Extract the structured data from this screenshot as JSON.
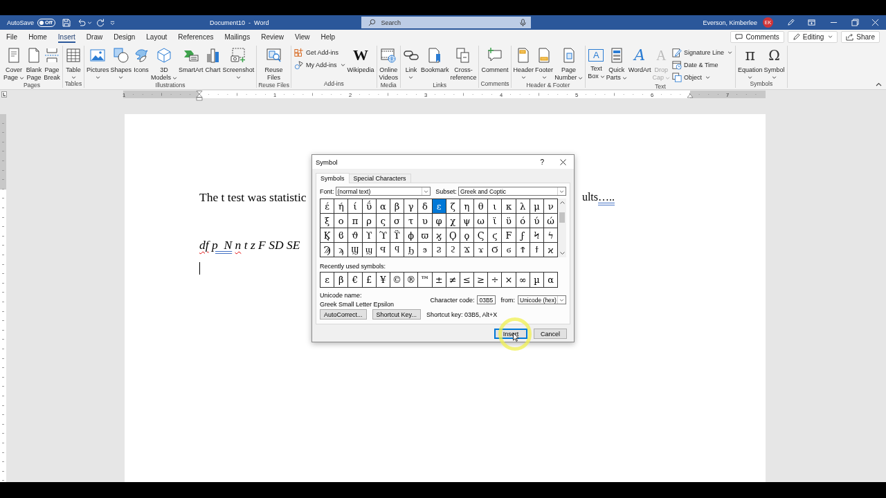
{
  "title_bar": {
    "autosave": {
      "label": "AutoSave",
      "state_label": "Off",
      "on": false
    },
    "title": "Document10  -  Word",
    "search": {
      "placeholder": "Search"
    },
    "user": {
      "name": "Everson, Kimberlee",
      "initials": "EK"
    }
  },
  "ribbon_tabs": [
    {
      "label": "File",
      "selected": false
    },
    {
      "label": "Home",
      "selected": false
    },
    {
      "label": "Insert",
      "selected": true
    },
    {
      "label": "Draw",
      "selected": false
    },
    {
      "label": "Design",
      "selected": false
    },
    {
      "label": "Layout",
      "selected": false
    },
    {
      "label": "References",
      "selected": false
    },
    {
      "label": "Mailings",
      "selected": false
    },
    {
      "label": "Review",
      "selected": false
    },
    {
      "label": "View",
      "selected": false
    },
    {
      "label": "Help",
      "selected": false
    }
  ],
  "ribbon_actions": [
    {
      "label": "Comments",
      "dropdown": false
    },
    {
      "label": "Editing",
      "dropdown": true
    },
    {
      "label": "Share",
      "dropdown": false
    }
  ],
  "ribbon_groups": [
    {
      "label": "Pages",
      "commands": [
        {
          "kind": "large",
          "label": "Cover Page",
          "dropdown": true,
          "disabled": false
        },
        {
          "kind": "large",
          "label": "Blank Page",
          "dropdown": false,
          "disabled": false
        },
        {
          "kind": "large",
          "label": "Page Break",
          "dropdown": false,
          "disabled": false
        }
      ]
    },
    {
      "label": "Tables",
      "commands": [
        {
          "kind": "large",
          "label": "Table",
          "dropdown": true,
          "disabled": false
        }
      ]
    },
    {
      "label": "Illustrations",
      "commands": [
        {
          "kind": "large",
          "label": "Pictures",
          "dropdown": true,
          "disabled": false
        },
        {
          "kind": "large",
          "label": "Shapes",
          "dropdown": true,
          "disabled": false
        },
        {
          "kind": "large",
          "label": "Icons",
          "dropdown": false,
          "disabled": false
        },
        {
          "kind": "large",
          "label": "3D Models",
          "dropdown": true,
          "disabled": false
        },
        {
          "kind": "large",
          "label": "SmartArt",
          "dropdown": false,
          "disabled": false
        },
        {
          "kind": "large",
          "label": "Chart",
          "dropdown": false,
          "disabled": false
        },
        {
          "kind": "large",
          "label": "Screenshot",
          "dropdown": true,
          "disabled": false
        }
      ]
    },
    {
      "label": "Reuse Files",
      "commands": [
        {
          "kind": "large",
          "label": "Reuse Files",
          "dropdown": false,
          "disabled": false
        }
      ]
    },
    {
      "label": "Add-ins",
      "commands": [
        {
          "kind": "small",
          "label": "Get Add-ins",
          "dropdown": false,
          "disabled": false
        },
        {
          "kind": "small",
          "label": "My Add-ins",
          "dropdown": true,
          "disabled": false
        },
        {
          "kind": "large",
          "label": "Wikipedia",
          "glyph": "W",
          "dropdown": false,
          "disabled": false
        }
      ]
    },
    {
      "label": "Media",
      "commands": [
        {
          "kind": "large",
          "label": "Online Videos",
          "dropdown": false,
          "disabled": false
        }
      ]
    },
    {
      "label": "Links",
      "commands": [
        {
          "kind": "large",
          "label": "Link",
          "dropdown": true,
          "disabled": false
        },
        {
          "kind": "large",
          "label": "Bookmark",
          "dropdown": false,
          "disabled": false
        },
        {
          "kind": "large",
          "label": "Cross-reference",
          "dropdown": false,
          "disabled": false
        }
      ]
    },
    {
      "label": "Comments",
      "commands": [
        {
          "kind": "large",
          "label": "Comment",
          "dropdown": false,
          "disabled": false
        }
      ]
    },
    {
      "label": "Header & Footer",
      "commands": [
        {
          "kind": "large",
          "label": "Header",
          "dropdown": true,
          "disabled": false
        },
        {
          "kind": "large",
          "label": "Footer",
          "dropdown": true,
          "disabled": false
        },
        {
          "kind": "large",
          "label": "Page Number",
          "dropdown": true,
          "disabled": false
        }
      ]
    },
    {
      "label": "Text",
      "commands": [
        {
          "kind": "large",
          "label": "Text Box",
          "glyph": "A",
          "dropdown": true,
          "disabled": false
        },
        {
          "kind": "large",
          "label": "Quick Parts",
          "dropdown": true,
          "disabled": false
        },
        {
          "kind": "large",
          "label": "WordArt",
          "glyph": "A",
          "dropdown": false,
          "disabled": false
        },
        {
          "kind": "large",
          "label": "Drop Cap",
          "glyph": "A",
          "dropdown": true,
          "disabled": true
        },
        {
          "kind": "small",
          "label": "Signature Line",
          "dropdown": true,
          "disabled": false
        },
        {
          "kind": "small",
          "label": "Date & Time",
          "dropdown": false,
          "disabled": false
        },
        {
          "kind": "small",
          "label": "Object",
          "dropdown": true,
          "disabled": false
        }
      ]
    },
    {
      "label": "Symbols",
      "commands": [
        {
          "kind": "large",
          "label": "Equation",
          "glyph": "π",
          "dropdown": true,
          "disabled": false
        },
        {
          "kind": "large",
          "label": "Symbol",
          "glyph": "Ω",
          "dropdown": true,
          "disabled": false
        }
      ]
    }
  ],
  "ruler": {
    "numbers": [
      "1",
      "1",
      "2",
      "3",
      "4",
      "5",
      "6",
      "7"
    ]
  },
  "document": {
    "paragraphs": [
      {
        "kind": "covered",
        "before": "The t test was statistic",
        "after": [
          {
            "text": "ults",
            "spelling_error": false,
            "grammar_error": false
          },
          {
            "text": "…..",
            "spelling_error": false,
            "grammar_error": true
          }
        ]
      },
      {
        "kind": "italic",
        "runs": [
          {
            "text": "df",
            "spelling_error": true,
            "grammar_error": false
          },
          {
            "text": "p  N",
            "spelling_error": false,
            "grammar_error": true
          },
          {
            "text": "n",
            "spelling_error": true,
            "grammar_error": false
          },
          {
            "text": "t z F SD SE",
            "spelling_error": false,
            "grammar_error": false
          }
        ]
      }
    ],
    "cursor": true
  },
  "symbol_dialog": {
    "title": "Symbol",
    "help": "?",
    "tabs": [
      {
        "label": "Symbols",
        "selected": true
      },
      {
        "label": "Special Characters",
        "selected": false
      }
    ],
    "font": {
      "label": "Font:",
      "value": "(normal text)"
    },
    "subset": {
      "label": "Subset:",
      "value": "Greek and Coptic"
    },
    "symbols": [
      {
        "char": "έ",
        "selected": false
      },
      {
        "char": "ή",
        "selected": false
      },
      {
        "char": "ί",
        "selected": false
      },
      {
        "char": "ΰ",
        "selected": false
      },
      {
        "char": "α",
        "selected": false
      },
      {
        "char": "β",
        "selected": false
      },
      {
        "char": "γ",
        "selected": false
      },
      {
        "char": "δ",
        "selected": false
      },
      {
        "char": "ε",
        "selected": true
      },
      {
        "char": "ζ",
        "selected": false
      },
      {
        "char": "η",
        "selected": false
      },
      {
        "char": "θ",
        "selected": false
      },
      {
        "char": "ι",
        "selected": false
      },
      {
        "char": "κ",
        "selected": false
      },
      {
        "char": "λ",
        "selected": false
      },
      {
        "char": "μ",
        "selected": false
      },
      {
        "char": "ν",
        "selected": false
      },
      {
        "char": "ξ",
        "selected": false
      },
      {
        "char": "ο",
        "selected": false
      },
      {
        "char": "π",
        "selected": false
      },
      {
        "char": "ρ",
        "selected": false
      },
      {
        "char": "ς",
        "selected": false
      },
      {
        "char": "σ",
        "selected": false
      },
      {
        "char": "τ",
        "selected": false
      },
      {
        "char": "υ",
        "selected": false
      },
      {
        "char": "φ",
        "selected": false
      },
      {
        "char": "χ",
        "selected": false
      },
      {
        "char": "ψ",
        "selected": false
      },
      {
        "char": "ω",
        "selected": false
      },
      {
        "char": "ϊ",
        "selected": false
      },
      {
        "char": "ϋ",
        "selected": false
      },
      {
        "char": "ό",
        "selected": false
      },
      {
        "char": "ύ",
        "selected": false
      },
      {
        "char": "ώ",
        "selected": false
      },
      {
        "char": "Ϗ",
        "selected": false
      },
      {
        "char": "ϐ",
        "selected": false
      },
      {
        "char": "ϑ",
        "selected": false
      },
      {
        "char": "ϒ",
        "selected": false
      },
      {
        "char": "ϓ",
        "selected": false
      },
      {
        "char": "ϔ",
        "selected": false
      },
      {
        "char": "ϕ",
        "selected": false
      },
      {
        "char": "ϖ",
        "selected": false
      },
      {
        "char": "ϗ",
        "selected": false
      },
      {
        "char": "Ϙ",
        "selected": false
      },
      {
        "char": "ϙ",
        "selected": false
      },
      {
        "char": "Ϛ",
        "selected": false
      },
      {
        "char": "ϛ",
        "selected": false
      },
      {
        "char": "Ϝ",
        "selected": false
      },
      {
        "char": "ϝ",
        "selected": false
      },
      {
        "char": "Ϟ",
        "selected": false
      },
      {
        "char": "ϟ",
        "selected": false
      },
      {
        "char": "Ϡ",
        "selected": false
      },
      {
        "char": "ϡ",
        "selected": false
      },
      {
        "char": "Ϣ",
        "selected": false
      },
      {
        "char": "ϣ",
        "selected": false
      },
      {
        "char": "Ϥ",
        "selected": false
      },
      {
        "char": "ϥ",
        "selected": false
      },
      {
        "char": "Ϧ",
        "selected": false
      },
      {
        "char": "ϧ",
        "selected": false
      },
      {
        "char": "Ϩ",
        "selected": false
      },
      {
        "char": "ϩ",
        "selected": false
      },
      {
        "char": "Ϫ",
        "selected": false
      },
      {
        "char": "ϫ",
        "selected": false
      },
      {
        "char": "Ϭ",
        "selected": false
      },
      {
        "char": "ϭ",
        "selected": false
      },
      {
        "char": "Ϯ",
        "selected": false
      },
      {
        "char": "ϯ",
        "selected": false
      },
      {
        "char": "ϰ",
        "selected": false
      }
    ],
    "recent_label": "Recently used symbols:",
    "recent": [
      {
        "char": "ε",
        "selected": false
      },
      {
        "char": "β",
        "selected": false
      },
      {
        "char": "€",
        "selected": false
      },
      {
        "char": "£",
        "selected": false
      },
      {
        "char": "¥",
        "selected": false
      },
      {
        "char": "©",
        "selected": false
      },
      {
        "char": "®",
        "selected": false
      },
      {
        "char": "™",
        "selected": false
      },
      {
        "char": "±",
        "selected": false
      },
      {
        "char": "≠",
        "selected": false
      },
      {
        "char": "≤",
        "selected": false
      },
      {
        "char": "≥",
        "selected": false
      },
      {
        "char": "÷",
        "selected": false
      },
      {
        "char": "×",
        "selected": false
      },
      {
        "char": "∞",
        "selected": false
      },
      {
        "char": "µ",
        "selected": false
      },
      {
        "char": "α",
        "selected": false
      }
    ],
    "unicode_name_label": "Unicode name:",
    "unicode_name": "Greek Small Letter Epsilon",
    "character_code": {
      "label": "Character code:",
      "value": "03B5"
    },
    "from": {
      "label": "from:",
      "value": "Unicode (hex)"
    },
    "buttons": [
      {
        "label": "AutoCorrect..."
      },
      {
        "label": "Shortcut Key..."
      }
    ],
    "shortcut_text": "Shortcut key: 03B5, Alt+X",
    "actions": [
      {
        "label": "Insert",
        "focused": true
      },
      {
        "label": "Cancel",
        "focused": false
      }
    ]
  }
}
